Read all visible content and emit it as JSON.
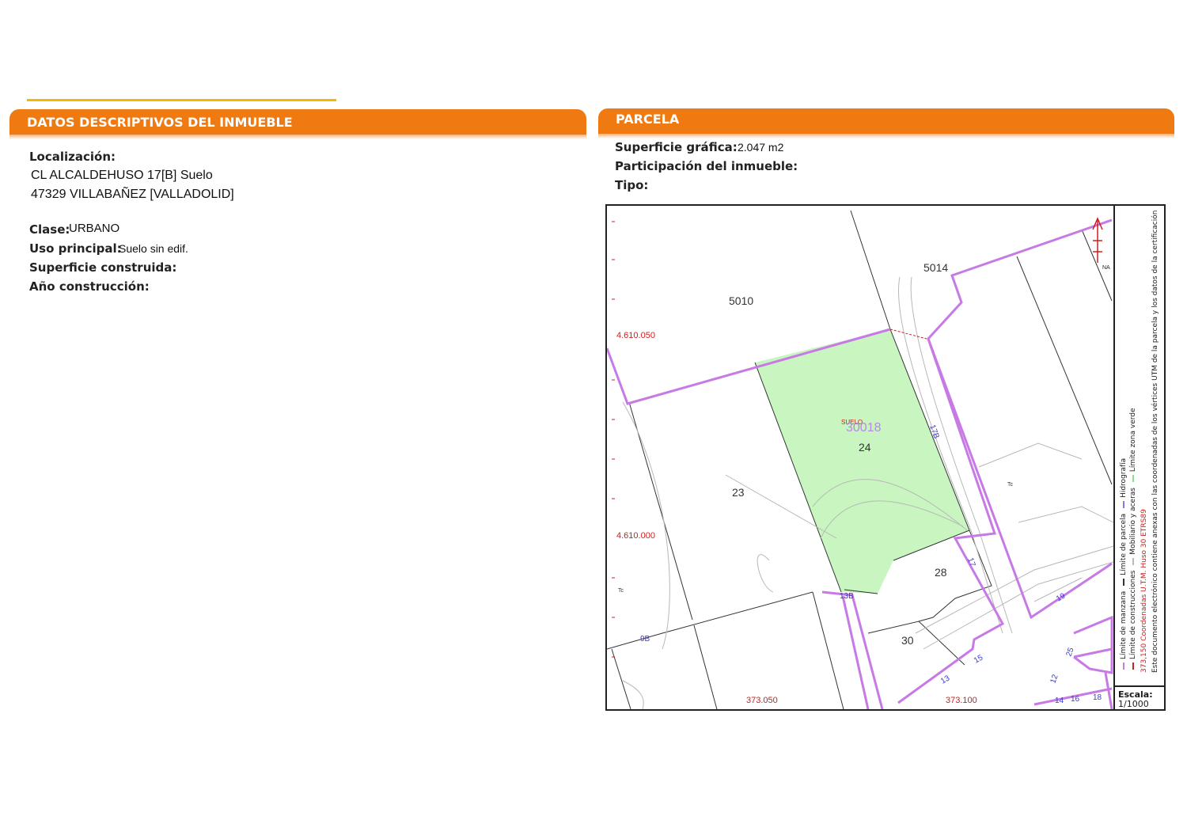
{
  "left_panel": {
    "title": "DATOS DESCRIPTIVOS DEL INMUEBLE",
    "localizacion_label": "Localización:",
    "address_line1": "CL ALCALDEHUSO 17[B] Suelo",
    "address_line2": "47329 VILLABAÑEZ [VALLADOLID]",
    "clase_label": "Clase:",
    "clase_value": "URBANO",
    "uso_label": "Uso principal:",
    "uso_value": "Suelo sin edif.",
    "superficie_label": "Superficie construida:",
    "anio_label": "Año construcción:"
  },
  "right_panel": {
    "title": "PARCELA",
    "superficie_label": "Superficie gráfica:",
    "superficie_value": "2.047 m2",
    "participacion_label": "Participación del inmueble:",
    "tipo_label": "Tipo:"
  },
  "map": {
    "parcel_ref": "30018",
    "parcel_use": "SUELO",
    "parcel_labels": [
      "5014",
      "5010",
      "24",
      "23",
      "28",
      "30"
    ],
    "coord_y_labels": [
      "4.610.050",
      "4.610.000"
    ],
    "coord_x_labels": [
      "373.050",
      "373.100"
    ],
    "street_numbers": [
      "17B",
      "17",
      "13B",
      "9B",
      "19",
      "25",
      "15",
      "13",
      "12",
      "14",
      "16",
      "18"
    ],
    "symbols": [
      "Tc",
      "Tc"
    ],
    "north_label": "NA",
    "colors": {
      "parcel_fill": "#c8f5c0",
      "manzana_line": "#c77ae6",
      "parcel_line": "#333333",
      "coord_text": "#cc1f1f",
      "number_text": "#3a3ad0"
    }
  },
  "legend": {
    "items": [
      "Límite de manzana",
      "Límite de parcela",
      "Hidrografía",
      "Límite de construcciones",
      "Mobiliario y aceras",
      "Límite zona verde"
    ],
    "coords_text": "373,150 Coordenadas U.T.M. Huso 30 ETRS89",
    "certification_text": "Este documento electrónico contiene anexas con las coordenadas de los vértices UTM de la parcela y los datos de la certificación",
    "escala_label": "Escala:",
    "escala_value": "1/1000"
  }
}
